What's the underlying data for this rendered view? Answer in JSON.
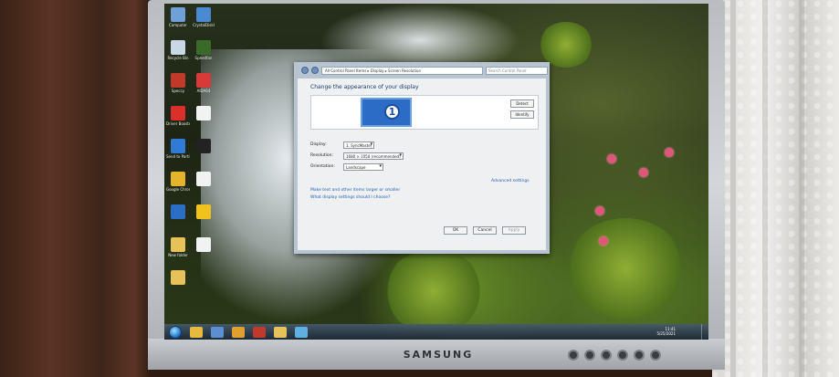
{
  "monitor": {
    "brand": "SAMSUNG"
  },
  "desktop_icons": [
    {
      "label": "Computer",
      "icon": "computer-icon",
      "color": "#6fa0d8"
    },
    {
      "label": "CrystalDiskI",
      "icon": "app-icon",
      "color": "#4b8ad0"
    },
    {
      "label": "Recycle Bin",
      "icon": "recycle-bin-icon",
      "color": "#c8d8e6"
    },
    {
      "label": "Speedfan",
      "icon": "fan-icon",
      "color": "#3a6a2a"
    },
    {
      "label": "Speccy",
      "icon": "app-icon",
      "color": "#c0392b"
    },
    {
      "label": "AIDA64",
      "icon": "app-icon",
      "color": "#d83a3a"
    },
    {
      "label": "Driver Booster",
      "icon": "app-icon",
      "color": "#d9302c"
    },
    {
      "label": "",
      "icon": "document-icon",
      "color": "#f2f2f2"
    },
    {
      "label": "Send to Partition...",
      "icon": "app-icon",
      "color": "#2f7bd6"
    },
    {
      "label": "",
      "icon": "app-icon",
      "color": "#222222"
    },
    {
      "label": "Google Chrome",
      "icon": "chrome-icon",
      "color": "#e4b42a"
    },
    {
      "label": "",
      "icon": "document-icon",
      "color": "#f2f2f2"
    },
    {
      "label": "",
      "icon": "app-icon",
      "color": "#2a6ec8"
    },
    {
      "label": "",
      "icon": "app-icon",
      "color": "#f1c21c"
    },
    {
      "label": "New folder",
      "icon": "folder-icon",
      "color": "#e7c25a"
    },
    {
      "label": "",
      "icon": "document-icon",
      "color": "#f2f2f2"
    },
    {
      "label": "",
      "icon": "folder-icon",
      "color": "#e7c25a"
    }
  ],
  "dialog": {
    "address": "All Control Panel Items ▸ Display ▸ Screen Resolution",
    "search_placeholder": "Search Control Panel",
    "heading": "Change the appearance of your display",
    "monitor_number": "1",
    "detect_label": "Detect",
    "identify_label": "Identify",
    "display_label": "Display:",
    "display_value": "1. SyncMaster",
    "resolution_label": "Resolution:",
    "resolution_value": "1680 × 1050 (recommended)",
    "orientation_label": "Orientation:",
    "orientation_value": "Landscape",
    "advanced_link": "Advanced settings",
    "link1": "Make text and other items larger or smaller",
    "link2": "What display settings should I choose?",
    "ok_label": "OK",
    "cancel_label": "Cancel",
    "apply_label": "Apply"
  },
  "taskbar": {
    "apps": [
      {
        "icon": "explorer-icon",
        "color": "#e6b93f"
      },
      {
        "icon": "media-player-icon",
        "color": "#5a8fd0"
      },
      {
        "icon": "chrome-icon",
        "color": "#e0a030"
      },
      {
        "icon": "app-icon",
        "color": "#c0392b"
      },
      {
        "icon": "folder-icon",
        "color": "#e7c25a"
      },
      {
        "icon": "control-panel-icon",
        "color": "#5fb0e0"
      }
    ],
    "time": "11:41",
    "date": "5/25/2021"
  }
}
